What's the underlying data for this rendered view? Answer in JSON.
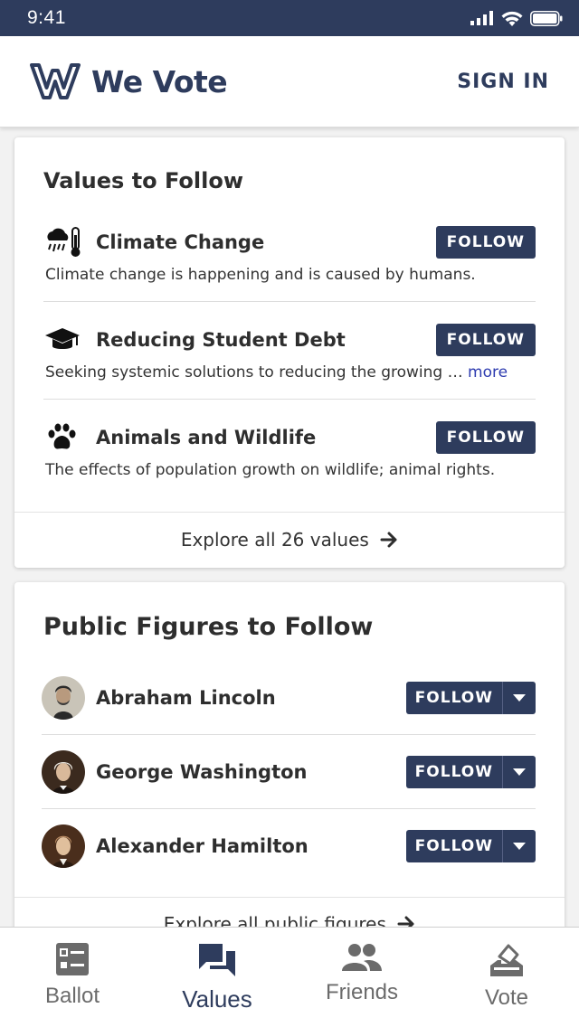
{
  "status": {
    "time": "9:41"
  },
  "header": {
    "brand": "We Vote",
    "signin": "SIGN IN"
  },
  "values_card": {
    "title": "Values to Follow",
    "items": [
      {
        "name": "Climate Change",
        "icon": "climate-icon",
        "desc": "Climate change is happening and is caused by humans.",
        "follow": "FOLLOW"
      },
      {
        "name": "Reducing Student Debt",
        "icon": "graduation-cap-icon",
        "desc": "Seeking systemic solutions to reducing the growing …",
        "more": "more",
        "follow": "FOLLOW"
      },
      {
        "name": "Animals and Wildlife",
        "icon": "paw-icon",
        "desc": "The effects of population growth on wildlife; animal rights.",
        "follow": "FOLLOW"
      }
    ],
    "explore": "Explore all 26 values"
  },
  "figures_card": {
    "title": "Public Figures to Follow",
    "items": [
      {
        "name": "Abraham Lincoln",
        "follow": "FOLLOW"
      },
      {
        "name": "George Washington",
        "follow": "FOLLOW"
      },
      {
        "name": "Alexander Hamilton",
        "follow": "FOLLOW"
      }
    ],
    "explore": "Explore all public figures"
  },
  "nav": {
    "items": [
      {
        "label": "Ballot",
        "icon": "ballot-icon"
      },
      {
        "label": "Values",
        "icon": "values-icon",
        "active": true
      },
      {
        "label": "Friends",
        "icon": "friends-icon"
      },
      {
        "label": "Vote",
        "icon": "vote-icon"
      }
    ]
  },
  "colors": {
    "primary": "#2e3c5d",
    "link": "#2e3cb0",
    "inactive": "#6b6b6b"
  }
}
